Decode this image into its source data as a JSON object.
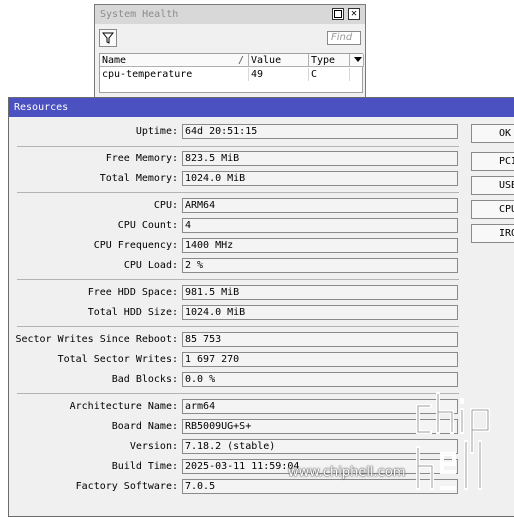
{
  "system_health": {
    "title": "System Health",
    "find_placeholder": "Find",
    "columns": [
      "Name",
      "Value",
      "Type"
    ],
    "rows": [
      {
        "name": "cpu-temperature",
        "value": "49",
        "type": "C"
      }
    ]
  },
  "resources": {
    "title": "Resources",
    "fields": {
      "uptime": {
        "label": "Uptime:",
        "value": "64d 20:51:15"
      },
      "free_memory": {
        "label": "Free Memory:",
        "value": "823.5 MiB"
      },
      "total_memory": {
        "label": "Total Memory:",
        "value": "1024.0 MiB"
      },
      "cpu": {
        "label": "CPU:",
        "value": "ARM64"
      },
      "cpu_count": {
        "label": "CPU Count:",
        "value": "4"
      },
      "cpu_frequency": {
        "label": "CPU Frequency:",
        "value": "1400 MHz"
      },
      "cpu_load": {
        "label": "CPU Load:",
        "value": "2 %"
      },
      "free_hdd": {
        "label": "Free HDD Space:",
        "value": "981.5 MiB"
      },
      "total_hdd": {
        "label": "Total HDD Size:",
        "value": "1024.0 MiB"
      },
      "sector_writes": {
        "label": "Sector Writes Since Reboot:",
        "value": "85 753"
      },
      "total_sector_writes": {
        "label": "Total Sector Writes:",
        "value": "1 697 270"
      },
      "bad_blocks": {
        "label": "Bad Blocks:",
        "value": "0.0 %"
      },
      "arch_name": {
        "label": "Architecture Name:",
        "value": "arm64"
      },
      "board_name": {
        "label": "Board Name:",
        "value": "RB5009UG+S+"
      },
      "version": {
        "label": "Version:",
        "value": "7.18.2 (stable)"
      },
      "build_time": {
        "label": "Build Time:",
        "value": "2025-03-11 11:59:04"
      },
      "factory_software": {
        "label": "Factory Software:",
        "value": "7.0.5"
      }
    },
    "buttons": {
      "ok": "OK",
      "pci": "PCI",
      "usb": "USB",
      "cpu": "CPU",
      "irq": "IRQ"
    }
  },
  "watermark": {
    "text": "www.chiphell.com",
    "logo": "chip hell"
  },
  "icons": {
    "filter": "filter-icon",
    "restore": "restore-window-icon",
    "close": "close-icon",
    "column_menu": "dropdown-arrow-icon"
  }
}
